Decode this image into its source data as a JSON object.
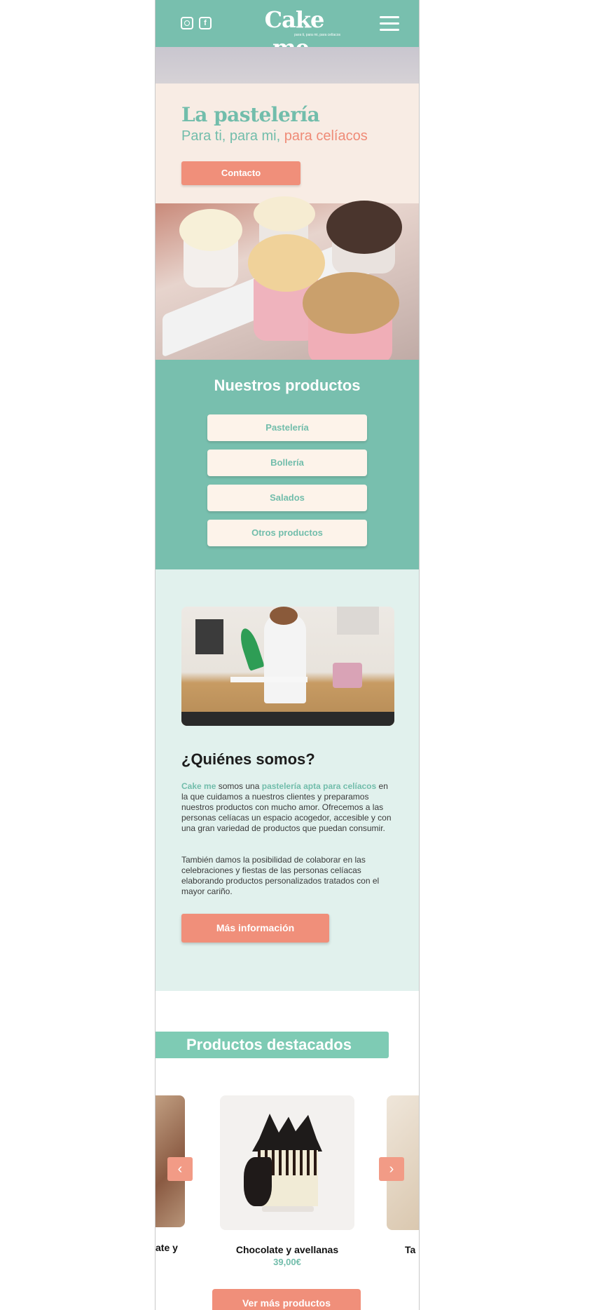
{
  "header": {
    "logo": "Cake me.",
    "tagline": "para ti, para mi, para celíacos",
    "instagram_icon": "instagram-icon",
    "facebook_icon": "facebook-icon",
    "facebook_glyph": "f",
    "menu_icon": "hamburger-menu-icon"
  },
  "hero": {
    "title": "La pastelería",
    "subtitle_main": "Para ti, para mi,",
    "subtitle_accent": "para celíacos",
    "contact_label": "Contacto"
  },
  "products": {
    "title": "Nuestros productos",
    "items": [
      "Pastelería",
      "Bollería",
      "Salados",
      "Otros productos"
    ]
  },
  "about": {
    "title": "¿Quiénes somos?",
    "p1_brand": "Cake me",
    "p1_mid": " somos una ",
    "p1_highlight": "pastelería apta para celíacos",
    "p1_rest": " en la que cuidamos a nuestros clientes y preparamos nuestros productos con mucho amor. Ofrecemos a las personas celíacas un espacio acogedor, accesible y con una gran variedad de productos que puedan consumir.",
    "p2": "También damos la posibilidad de colaborar en las celebraciones y fiestas de las personas celíacas elaborando productos personalizados tratados con el mayor cariño.",
    "more_label": "Más información"
  },
  "featured": {
    "title": "Productos destacados",
    "prev_card_name": "ate y",
    "main_card_name": "Chocolate y avellanas",
    "main_card_price": "39,00€",
    "next_card_name": "Ta",
    "prev_arrow": "‹",
    "next_arrow": "›",
    "see_more_label": "Ver más productos"
  },
  "colors": {
    "teal": "#78bfae",
    "salmon": "#f08f7a",
    "cream": "#fdf3ea",
    "mint_bg": "#e1f1ed"
  }
}
